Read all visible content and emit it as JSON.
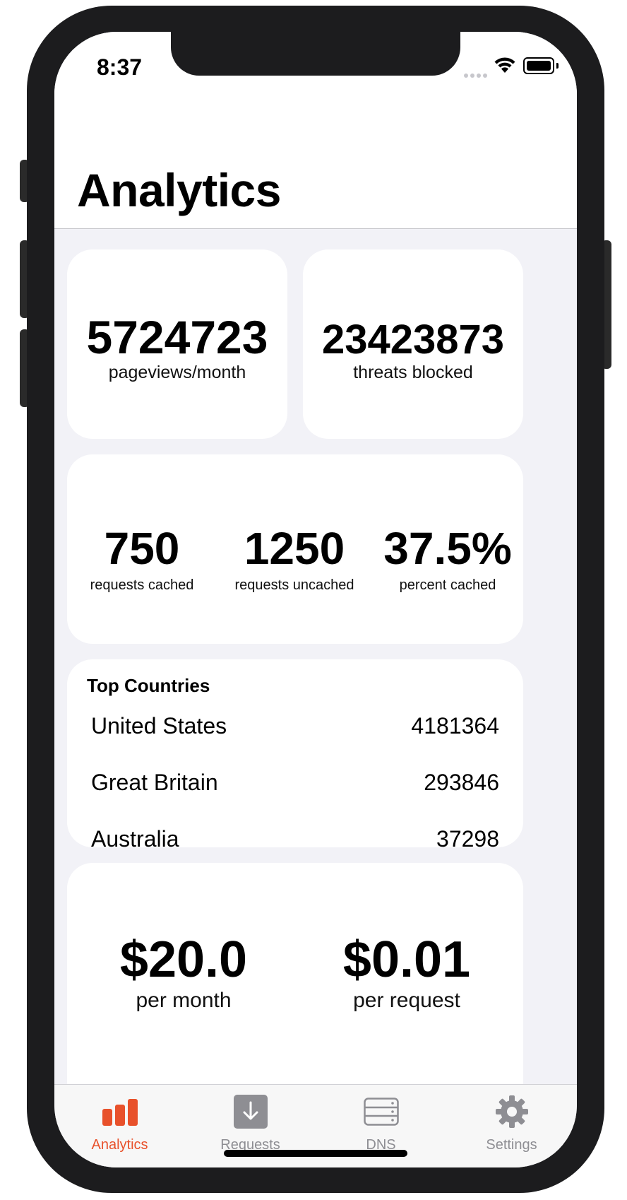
{
  "status_bar": {
    "time": "8:37"
  },
  "header": {
    "title": "Analytics"
  },
  "stats": {
    "pageviews": {
      "value": "5724723",
      "label": "pageviews/month"
    },
    "threats": {
      "value": "23423873",
      "label": "threats blocked"
    }
  },
  "caching": {
    "cached": {
      "value": "750",
      "label": "requests cached"
    },
    "uncached": {
      "value": "1250",
      "label": "requests uncached"
    },
    "percent": {
      "value": "37.5%",
      "label": "percent cached"
    }
  },
  "top_countries": {
    "title": "Top Countries",
    "rows": [
      {
        "name": "United States",
        "count": "4181364"
      },
      {
        "name": "Great Britain",
        "count": "293846"
      },
      {
        "name": "Australia",
        "count": "37298"
      }
    ]
  },
  "pricing": {
    "per_month": {
      "value": "$20.0",
      "label": "per month"
    },
    "per_request": {
      "value": "$0.01",
      "label": "per request"
    }
  },
  "tabs": [
    {
      "label": "Analytics",
      "icon": "bar-chart-icon",
      "active": true
    },
    {
      "label": "Requests",
      "icon": "download-icon",
      "active": false
    },
    {
      "label": "DNS",
      "icon": "server-icon",
      "active": false
    },
    {
      "label": "Settings",
      "icon": "gear-icon",
      "active": false
    }
  ],
  "colors": {
    "accent": "#e8512b",
    "inactive": "#8e8e93",
    "background": "#f2f2f7"
  }
}
